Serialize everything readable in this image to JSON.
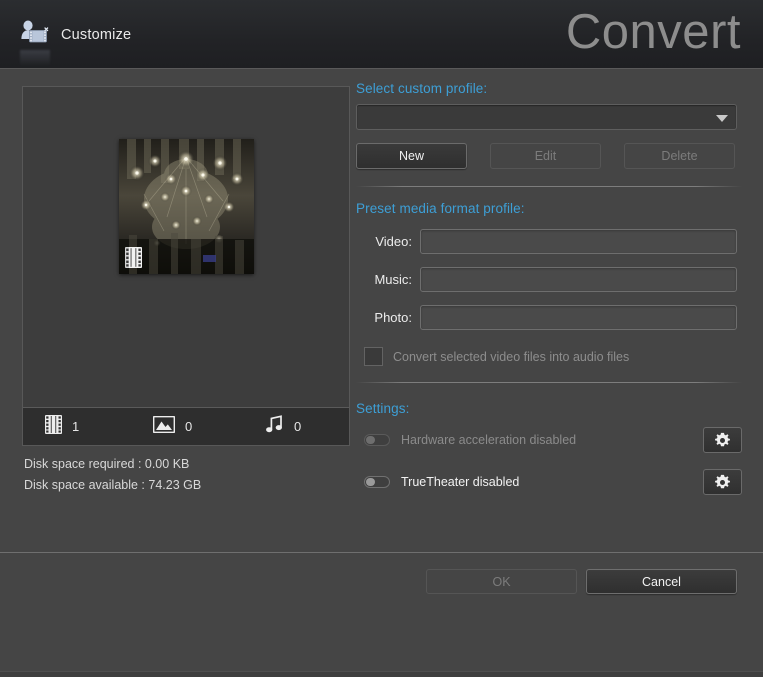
{
  "header": {
    "customize_label": "Customize",
    "title": "Convert",
    "icon": "customize-person-media-icon"
  },
  "preview": {
    "thumbnail_alt": "chandelier-video-thumbnail",
    "thumbnail_badge_icon": "film-strip-icon",
    "counts": [
      {
        "icon": "film-strip-icon",
        "label": "video-count",
        "value": "1"
      },
      {
        "icon": "photo-icon",
        "label": "photo-count",
        "value": "0"
      },
      {
        "icon": "music-note-icon",
        "label": "music-count",
        "value": "0"
      }
    ],
    "disk_required": "Disk space required : 0.00 KB",
    "disk_available": "Disk space available : 74.23 GB"
  },
  "custom_profile": {
    "section_label": "Select custom profile:",
    "dropdown_value": "",
    "dropdown_icon": "chevron-down-icon",
    "buttons": [
      {
        "label": "New",
        "state": "enabled"
      },
      {
        "label": "Edit",
        "state": "disabled"
      },
      {
        "label": "Delete",
        "state": "disabled"
      }
    ]
  },
  "preset_profile": {
    "section_label": "Preset media format profile:",
    "fields": [
      {
        "label": "Video:",
        "value": "",
        "placeholder": ""
      },
      {
        "label": "Music:",
        "value": "",
        "placeholder": ""
      },
      {
        "label": "Photo:",
        "value": "",
        "placeholder": ""
      }
    ],
    "checkbox": {
      "label": "Convert selected video files into audio files",
      "checked": false
    }
  },
  "settings": {
    "section_label": "Settings:",
    "toggles": [
      {
        "label": "Hardware acceleration disabled",
        "on": false,
        "enabled": false,
        "gear_icon": "gear-icon"
      },
      {
        "label": "TrueTheater disabled",
        "on": false,
        "enabled": true,
        "gear_icon": "gear-icon"
      }
    ]
  },
  "footer": {
    "ok_label": "OK",
    "ok_state": "disabled",
    "cancel_label": "Cancel",
    "cancel_state": "enabled"
  },
  "colors": {
    "accent_blue": "#3d9fd6",
    "header_bg": "#222326",
    "body_bg": "#454545",
    "panel_bg": "#3d3d3d",
    "text_primary": "#e8e8e8",
    "text_dim": "#8b8b8b"
  }
}
